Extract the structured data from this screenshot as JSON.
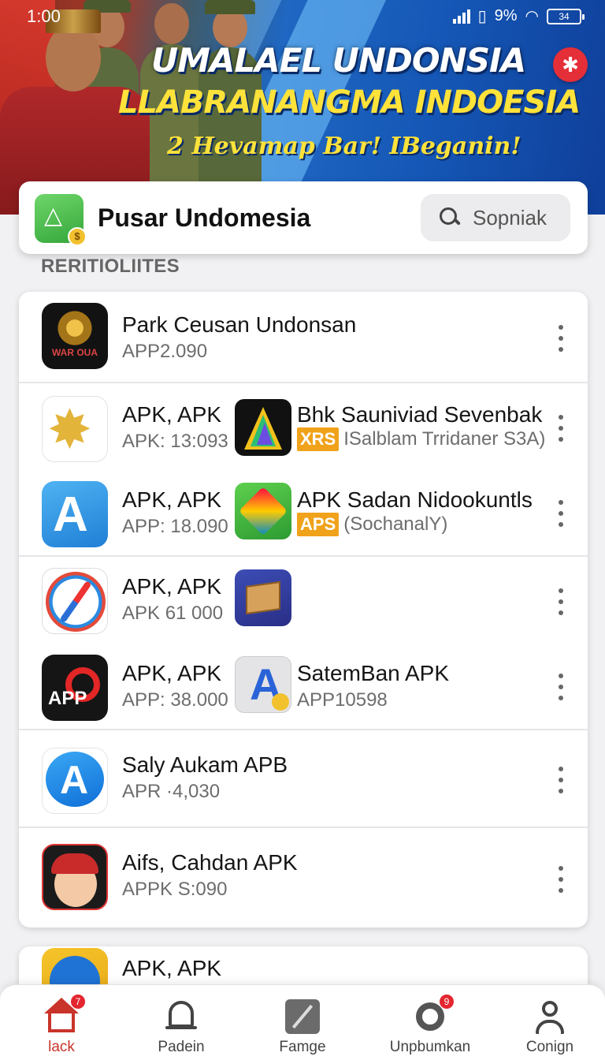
{
  "status_bar": {
    "time": "1:00",
    "battery_pct": "9%",
    "battery_text": "34"
  },
  "banner": {
    "headline": "UMALAEL UNDONSIA",
    "subheadline": "LLABRANANGMA INDOESIA",
    "tagline": "2 Hevamap Bar! IBeganin!"
  },
  "header": {
    "title": "Pusar Undomesia",
    "search_placeholder": "Sopniak"
  },
  "section_label": "RERITIOLIITES",
  "list": [
    {
      "name": "Park Ceusan Undonsan",
      "meta": "APP2.090",
      "icon": "garuda-emblem-icon"
    },
    {
      "name": "APK, APK",
      "meta": "APK: 13:093",
      "icon": "gold-star-icon",
      "secondary": {
        "name": "Bhk Sauniviad Sevenbak",
        "tag": "XRS",
        "meta": "ISalblam Trridaner S3A)",
        "icon": "prism-triangle-icon"
      }
    },
    {
      "name": "APK, APK",
      "meta": "APP: 18.090",
      "icon": "blue-a-icon",
      "secondary": {
        "name": "APK Sadan Nidookuntls",
        "tag": "APS",
        "meta": "(SochanalY)",
        "icon": "green-diamond-icon"
      }
    },
    {
      "name": "APK, APK",
      "meta": "APK 61 000",
      "icon": "compass-icon",
      "secondary": {
        "icon": "package-box-icon"
      }
    },
    {
      "name": "APK, APK",
      "meta": "APP: 38.000",
      "icon": "red-ring-icon",
      "icon_text": "APP",
      "secondary": {
        "name": "SatemBan APK",
        "meta": "APP10598",
        "icon": "grey-a-icon"
      }
    },
    {
      "name": "Saly Aukam APB",
      "meta": "APR ·4,030",
      "icon": "blue-bubble-icon"
    },
    {
      "name": "Aifs, Cahdan APK",
      "meta": "APPK S:090",
      "icon": "cartoon-face-icon"
    }
  ],
  "partial_row": {
    "name": "APK, APK",
    "icon": "yellow-blue-icon"
  },
  "bottom_nav": [
    {
      "label": "lack",
      "icon": "home-icon",
      "badge": "7",
      "active": true
    },
    {
      "label": "Padein",
      "icon": "bell-icon"
    },
    {
      "label": "Famge",
      "icon": "tile-icon"
    },
    {
      "label": "Unpbumkan",
      "icon": "ring-icon",
      "badge": "9"
    },
    {
      "label": "Conign",
      "icon": "user-icon"
    }
  ],
  "colors": {
    "accent": "#c9342a",
    "tag": "#f0a21a",
    "banner_blue": "#1557b6",
    "banner_yellow": "#ffe23a"
  }
}
